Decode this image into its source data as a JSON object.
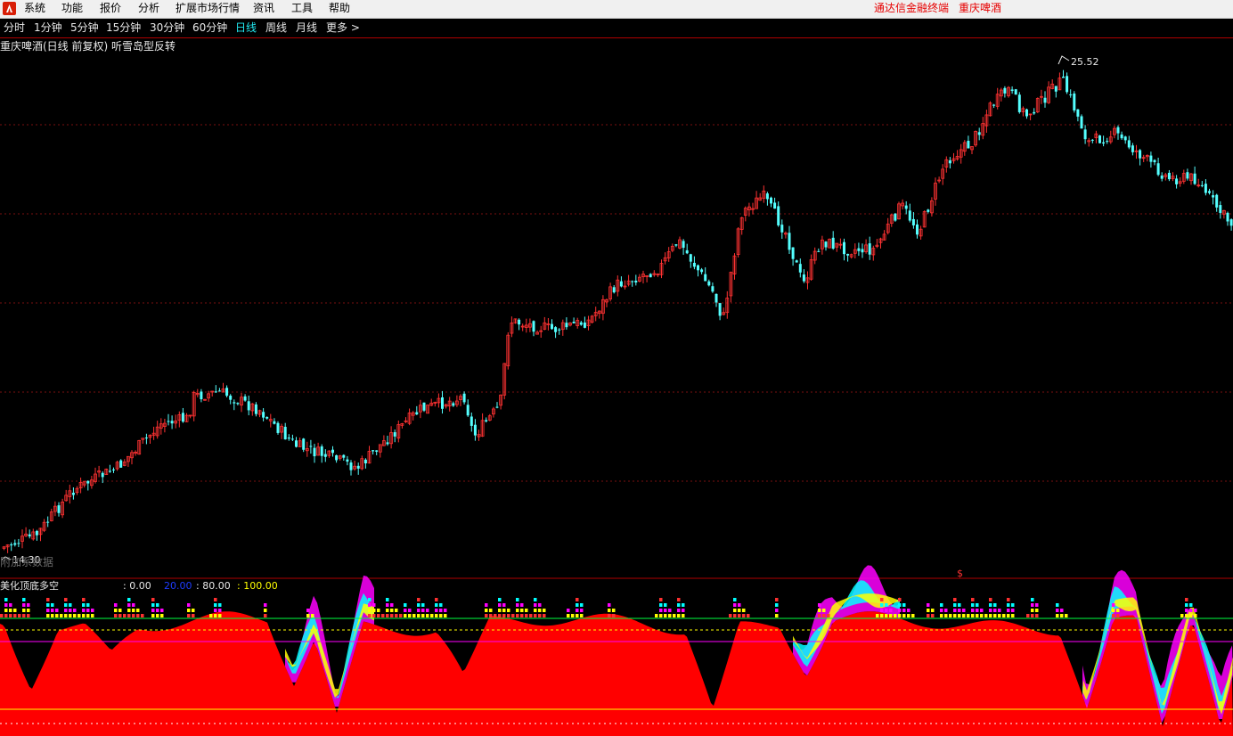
{
  "menu": {
    "items": [
      "系统",
      "功能",
      "报价",
      "分析",
      "扩展市场行情",
      "资讯",
      "工具",
      "帮助"
    ],
    "right_terminal": "通达信金融终端",
    "right_stock": "重庆啤酒"
  },
  "periods": {
    "items": [
      "分时",
      "1分钟",
      "5分钟",
      "15分钟",
      "30分钟",
      "60分钟",
      "日线",
      "周线",
      "月线",
      "更多 >"
    ],
    "active": "日线"
  },
  "main_chart": {
    "title": "重庆啤酒(日线 前复权) 听雪岛型反转",
    "high_label": "25.52",
    "low_label": "14.30",
    "watermark": "附加系数据"
  },
  "indicator": {
    "name": "美化顶底多空",
    "values": [
      {
        "label": ": 0.00",
        "color": "#e8e8e8"
      },
      {
        "label": "20.00",
        "color": "#1e3cff"
      },
      {
        "label": ": 80.00",
        "color": "#e8e8e8"
      },
      {
        "label": ": 100.00",
        "color": "#ffff00"
      }
    ]
  },
  "colors": {
    "up": "#ff3232",
    "down": "#54ffff",
    "red_fill": "#ff0000",
    "cyan": "#00ffff",
    "magenta": "#ff00ff",
    "yellow": "#ffff00",
    "menu_red": "#e60000"
  }
}
